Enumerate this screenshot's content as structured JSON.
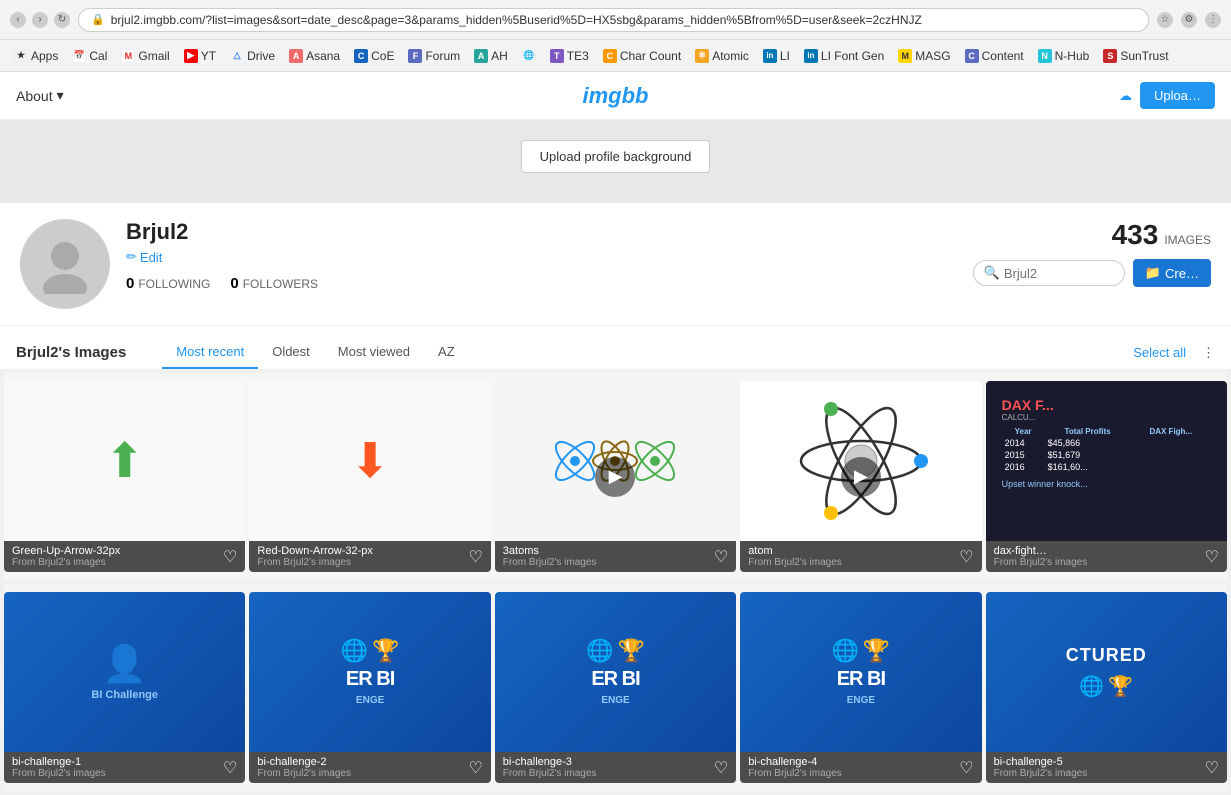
{
  "browser": {
    "address": "brjul2.imgbb.com/?list=images&sort=date_desc&page=3&params_hidden%5Buserid%5D=HX5sbg&params_hidden%5Bfrom%5D=user&seek=2czHNJZ",
    "back_title": "Back",
    "forward_title": "Forward",
    "refresh_title": "Refresh"
  },
  "bookmarks": [
    {
      "id": "apps",
      "label": "Apps",
      "icon": "★",
      "cls": "bk-apps"
    },
    {
      "id": "cal",
      "label": "Cal",
      "icon": "📅",
      "cls": "bk-cal"
    },
    {
      "id": "gmail",
      "label": "Gmail",
      "icon": "M",
      "cls": "bk-gmail"
    },
    {
      "id": "yt",
      "label": "YT",
      "icon": "▶",
      "cls": "bk-yt"
    },
    {
      "id": "drive",
      "label": "Drive",
      "icon": "△",
      "cls": "bk-drive"
    },
    {
      "id": "asana",
      "label": "Asana",
      "icon": "A",
      "cls": "bk-asana"
    },
    {
      "id": "coe",
      "label": "CoE",
      "icon": "C",
      "cls": "bk-coe"
    },
    {
      "id": "forum",
      "label": "Forum",
      "icon": "F",
      "cls": "bk-forum"
    },
    {
      "id": "ah",
      "label": "AH",
      "icon": "A",
      "cls": "bk-ah"
    },
    {
      "id": "globe",
      "label": "",
      "icon": "🌐",
      "cls": "bk-globe"
    },
    {
      "id": "te3",
      "label": "TE3",
      "icon": "T",
      "cls": "bk-te3"
    },
    {
      "id": "charcount",
      "label": "Char Count",
      "icon": "C",
      "cls": "bk-charcount"
    },
    {
      "id": "atomic",
      "label": "Atomic",
      "icon": "⚛",
      "cls": "bk-atomic"
    },
    {
      "id": "li",
      "label": "LI",
      "icon": "in",
      "cls": "bk-li"
    },
    {
      "id": "lifont",
      "label": "LI Font Gen",
      "icon": "in",
      "cls": "bk-lifont"
    },
    {
      "id": "masg",
      "label": "MASG",
      "icon": "M",
      "cls": "bk-masg"
    },
    {
      "id": "content",
      "label": "Content",
      "icon": "C",
      "cls": "bk-content"
    },
    {
      "id": "nhub",
      "label": "N-Hub",
      "icon": "N",
      "cls": "bk-nhub"
    },
    {
      "id": "sun",
      "label": "SunTrust",
      "icon": "S",
      "cls": "bk-sun"
    }
  ],
  "header": {
    "logo": "imgbb",
    "about_label": "About",
    "upload_label": "Uploa…"
  },
  "profile": {
    "upload_bg_label": "Upload profile background",
    "username": "Brjul2",
    "edit_label": "Edit",
    "following_count": "0",
    "following_label": "FOLLOWING",
    "followers_count": "0",
    "followers_label": "FOLLOWERS",
    "images_count": "433",
    "images_label": "IMAGES",
    "search_placeholder": "Brjul2",
    "create_label": "Cre…"
  },
  "images_section": {
    "title": "Brjul2's Images",
    "tabs": [
      {
        "id": "most-recent",
        "label": "Most recent",
        "active": true
      },
      {
        "id": "oldest",
        "label": "Oldest",
        "active": false
      },
      {
        "id": "most-viewed",
        "label": "Most viewed",
        "active": false
      },
      {
        "id": "az",
        "label": "AZ",
        "active": false
      }
    ],
    "select_all_label": "Select all",
    "images": [
      {
        "id": "green-up",
        "title": "Green-Up-Arrow-32px",
        "source": "From Brjul2's images",
        "type": "arrow-up",
        "bg": "#f9f9f9"
      },
      {
        "id": "red-down",
        "title": "Red-Down-Arrow-32-px",
        "source": "From Brjul2's images",
        "type": "arrow-down",
        "bg": "#f9f9f9"
      },
      {
        "id": "3atoms",
        "title": "3atoms",
        "source": "From Brjul2's images",
        "type": "atoms-video",
        "bg": "#f9f9f9"
      },
      {
        "id": "atom",
        "title": "atom",
        "source": "From Brjul2's images",
        "type": "atom",
        "bg": "white"
      },
      {
        "id": "dax-fight",
        "title": "dax-fight…",
        "source": "From Brjul2's images",
        "type": "dax",
        "bg": "#1a1a2e"
      },
      {
        "id": "bi1",
        "title": "bi-challenge-1",
        "source": "From Brjul2's images",
        "type": "bi-person",
        "bg": "#0d47a1"
      },
      {
        "id": "bi2",
        "title": "bi-challenge-2",
        "source": "From Brjul2's images",
        "type": "bi-er",
        "bg": "#0d47a1"
      },
      {
        "id": "bi3",
        "title": "bi-challenge-3",
        "source": "From Brjul2's images",
        "type": "bi-er2",
        "bg": "#0d47a1"
      },
      {
        "id": "bi4",
        "title": "bi-challenge-4",
        "source": "From Brjul2's images",
        "type": "bi-er3",
        "bg": "#0d47a1"
      },
      {
        "id": "bi5",
        "title": "bi-challenge-5",
        "source": "From Brjul2's images",
        "type": "bi-tured",
        "bg": "#0d47a1"
      }
    ]
  }
}
